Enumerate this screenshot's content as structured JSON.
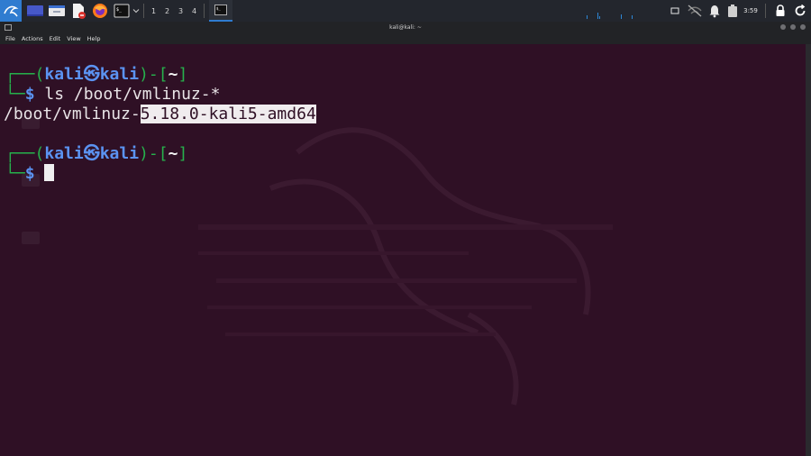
{
  "panel": {
    "workspaces": [
      "1",
      "2",
      "3",
      "4"
    ],
    "clock": "3:59",
    "icons": [
      "kali-menu-icon",
      "show-desktop-icon",
      "file-manager-icon",
      "text-editor-icon",
      "firefox-icon",
      "terminal-launcher-icon",
      "chevron-down-icon"
    ]
  },
  "window": {
    "title": "kali@kali: ~",
    "menu": [
      "File",
      "Actions",
      "Edit",
      "View",
      "Help"
    ]
  },
  "terminal": {
    "prompt_user": "kali",
    "prompt_host": "kali",
    "prompt_dir": "~",
    "command1": "ls /boot/vmlinuz-*",
    "output_prefix": "/boot/vmlinuz-",
    "output_selected": "5.18.0-kali5-amd64",
    "dollar": "$"
  },
  "colors": {
    "terminal_bg": "#2f1025",
    "prompt_green": "#26b14c",
    "prompt_blue": "#5b93f2",
    "panel_bg": "#23262d",
    "accent": "#2f7cd0"
  }
}
